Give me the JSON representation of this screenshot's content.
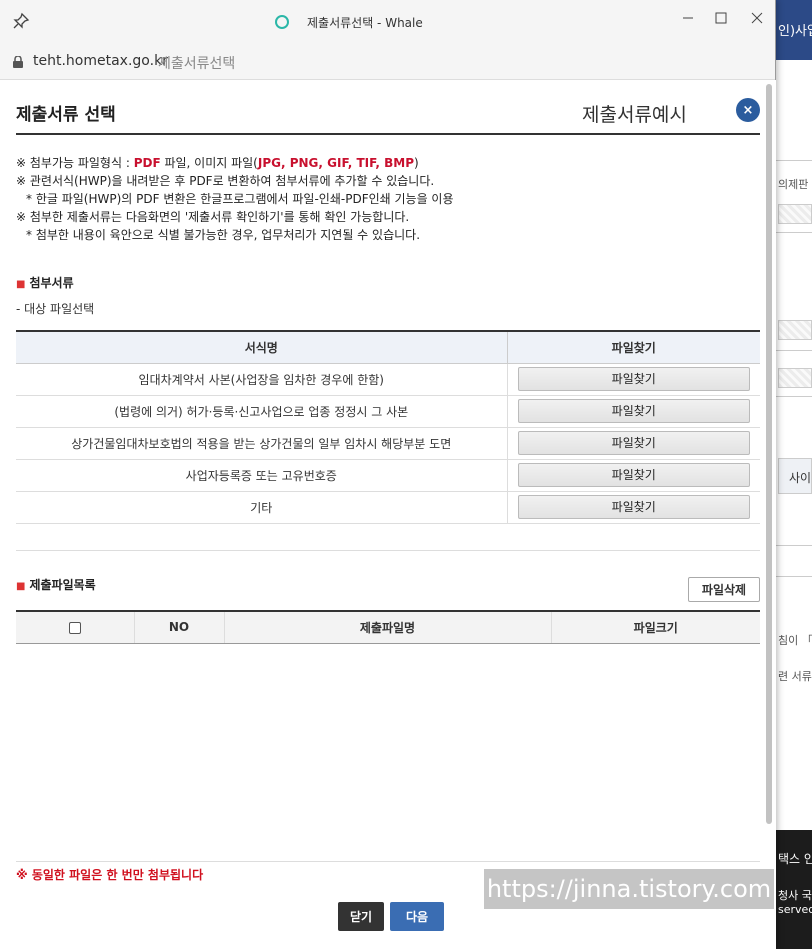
{
  "window": {
    "title": "제출서류선택 - Whale",
    "url_host": "teht.hometax.go.kr",
    "url_title": "제출서류선택",
    "icons": [
      "pin-icon",
      "whale-icon",
      "lock-icon",
      "minimize-icon",
      "maximize-icon",
      "close-icon"
    ]
  },
  "popup": {
    "title": "제출서류 선택",
    "example_link": "제출서류예시",
    "close_symbol": "×"
  },
  "notes": {
    "l1_prefix": "※ 첨부가능 파일형식 : ",
    "l1_pdf": "PDF",
    "l1_mid": " 파일, 이미지 파일(",
    "l1_img": "JPG, PNG, GIF, TIF, BMP",
    "l1_end": ")",
    "l2": "※ 관련서식(HWP)을 내려받은 후 PDF로 변환하여 첨부서류에 추가할 수 있습니다.",
    "l3": "* 한글 파일(HWP)의 PDF 변환은 한글프로그램에서 파일-인쇄-PDF인쇄 기능을 이용",
    "l4": "※ 첨부한 제출서류는 다음화면의 '제출서류 확인하기'를 통해 확인 가능합니다.",
    "l5": "* 첨부한 내용이 육안으로 식별 불가능한 경우, 업무처리가 지연될 수 있습니다."
  },
  "attach": {
    "heading": "첨부서류",
    "sub": "- 대상 파일선택",
    "col_name": "서식명",
    "col_find": "파일찾기",
    "find_label": "파일찾기",
    "rows": [
      "임대차계약서 사본(사업장을 임차한 경우에 한함)",
      "(법령에 의거) 허가·등록·신고사업으로 업종 정정시 그 사본",
      "상가건물임대차보호법의 적용을 받는 상가건물의 일부 임차시 해당부분 도면",
      "사업자등록증 또는 고유번호증",
      "기타"
    ]
  },
  "files": {
    "heading": "제출파일목록",
    "delete_label": "파일삭제",
    "col_no": "NO",
    "col_name": "제출파일명",
    "col_size": "파일크기"
  },
  "footer": {
    "warning": "※ 동일한 파일은 한 번만 첨부됩니다",
    "close_label": "닫기",
    "next_label": "다음"
  },
  "background": {
    "top_text": "인)사업",
    "t1": "의제판",
    "cell": "사이",
    "t2": "침이 「",
    "t3": "련 서류",
    "dark1": "택스 인",
    "dark2": "청사 국",
    "dark3": "served"
  },
  "watermark": "https://jinna.tistory.com",
  "colors": {
    "accent_red": "#c8102e",
    "button_blue": "#3a6db3",
    "header_blue": "#2b5c9e"
  }
}
